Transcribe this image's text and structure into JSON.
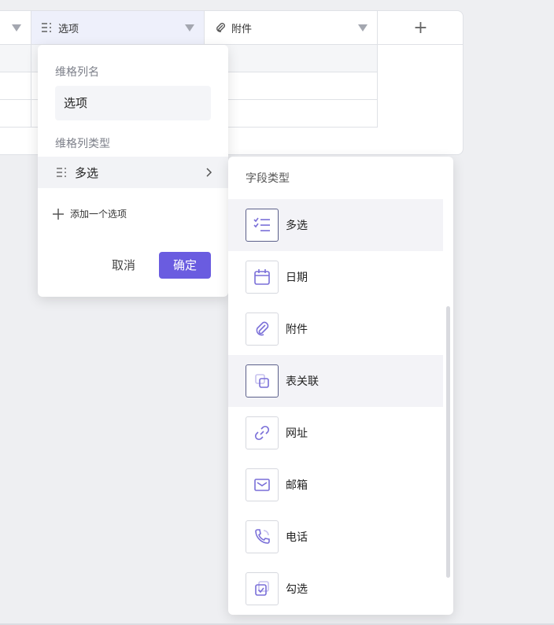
{
  "table": {
    "columns": [
      {
        "label": ""
      },
      {
        "label": "选项",
        "icon": "multi-select-icon"
      },
      {
        "label": "附件",
        "icon": "paperclip-icon"
      }
    ],
    "add_column_label": "+"
  },
  "field_editor": {
    "name_label": "维格列名",
    "name_value": "选项",
    "type_label": "维格列类型",
    "type_value": "多选",
    "add_option_label": "添加一个选项",
    "cancel_label": "取消",
    "confirm_label": "确定",
    "accent_color": "#6a5ce0"
  },
  "field_type_menu": {
    "title": "字段类型",
    "items": [
      {
        "label": "多选",
        "icon": "multi-select-icon"
      },
      {
        "label": "日期",
        "icon": "calendar-icon"
      },
      {
        "label": "附件",
        "icon": "paperclip-icon"
      },
      {
        "label": "表关联",
        "icon": "link-table-icon"
      },
      {
        "label": "网址",
        "icon": "link-icon"
      },
      {
        "label": "邮箱",
        "icon": "mail-icon"
      },
      {
        "label": "电话",
        "icon": "phone-icon"
      },
      {
        "label": "勾选",
        "icon": "checkbox-icon"
      }
    ]
  }
}
